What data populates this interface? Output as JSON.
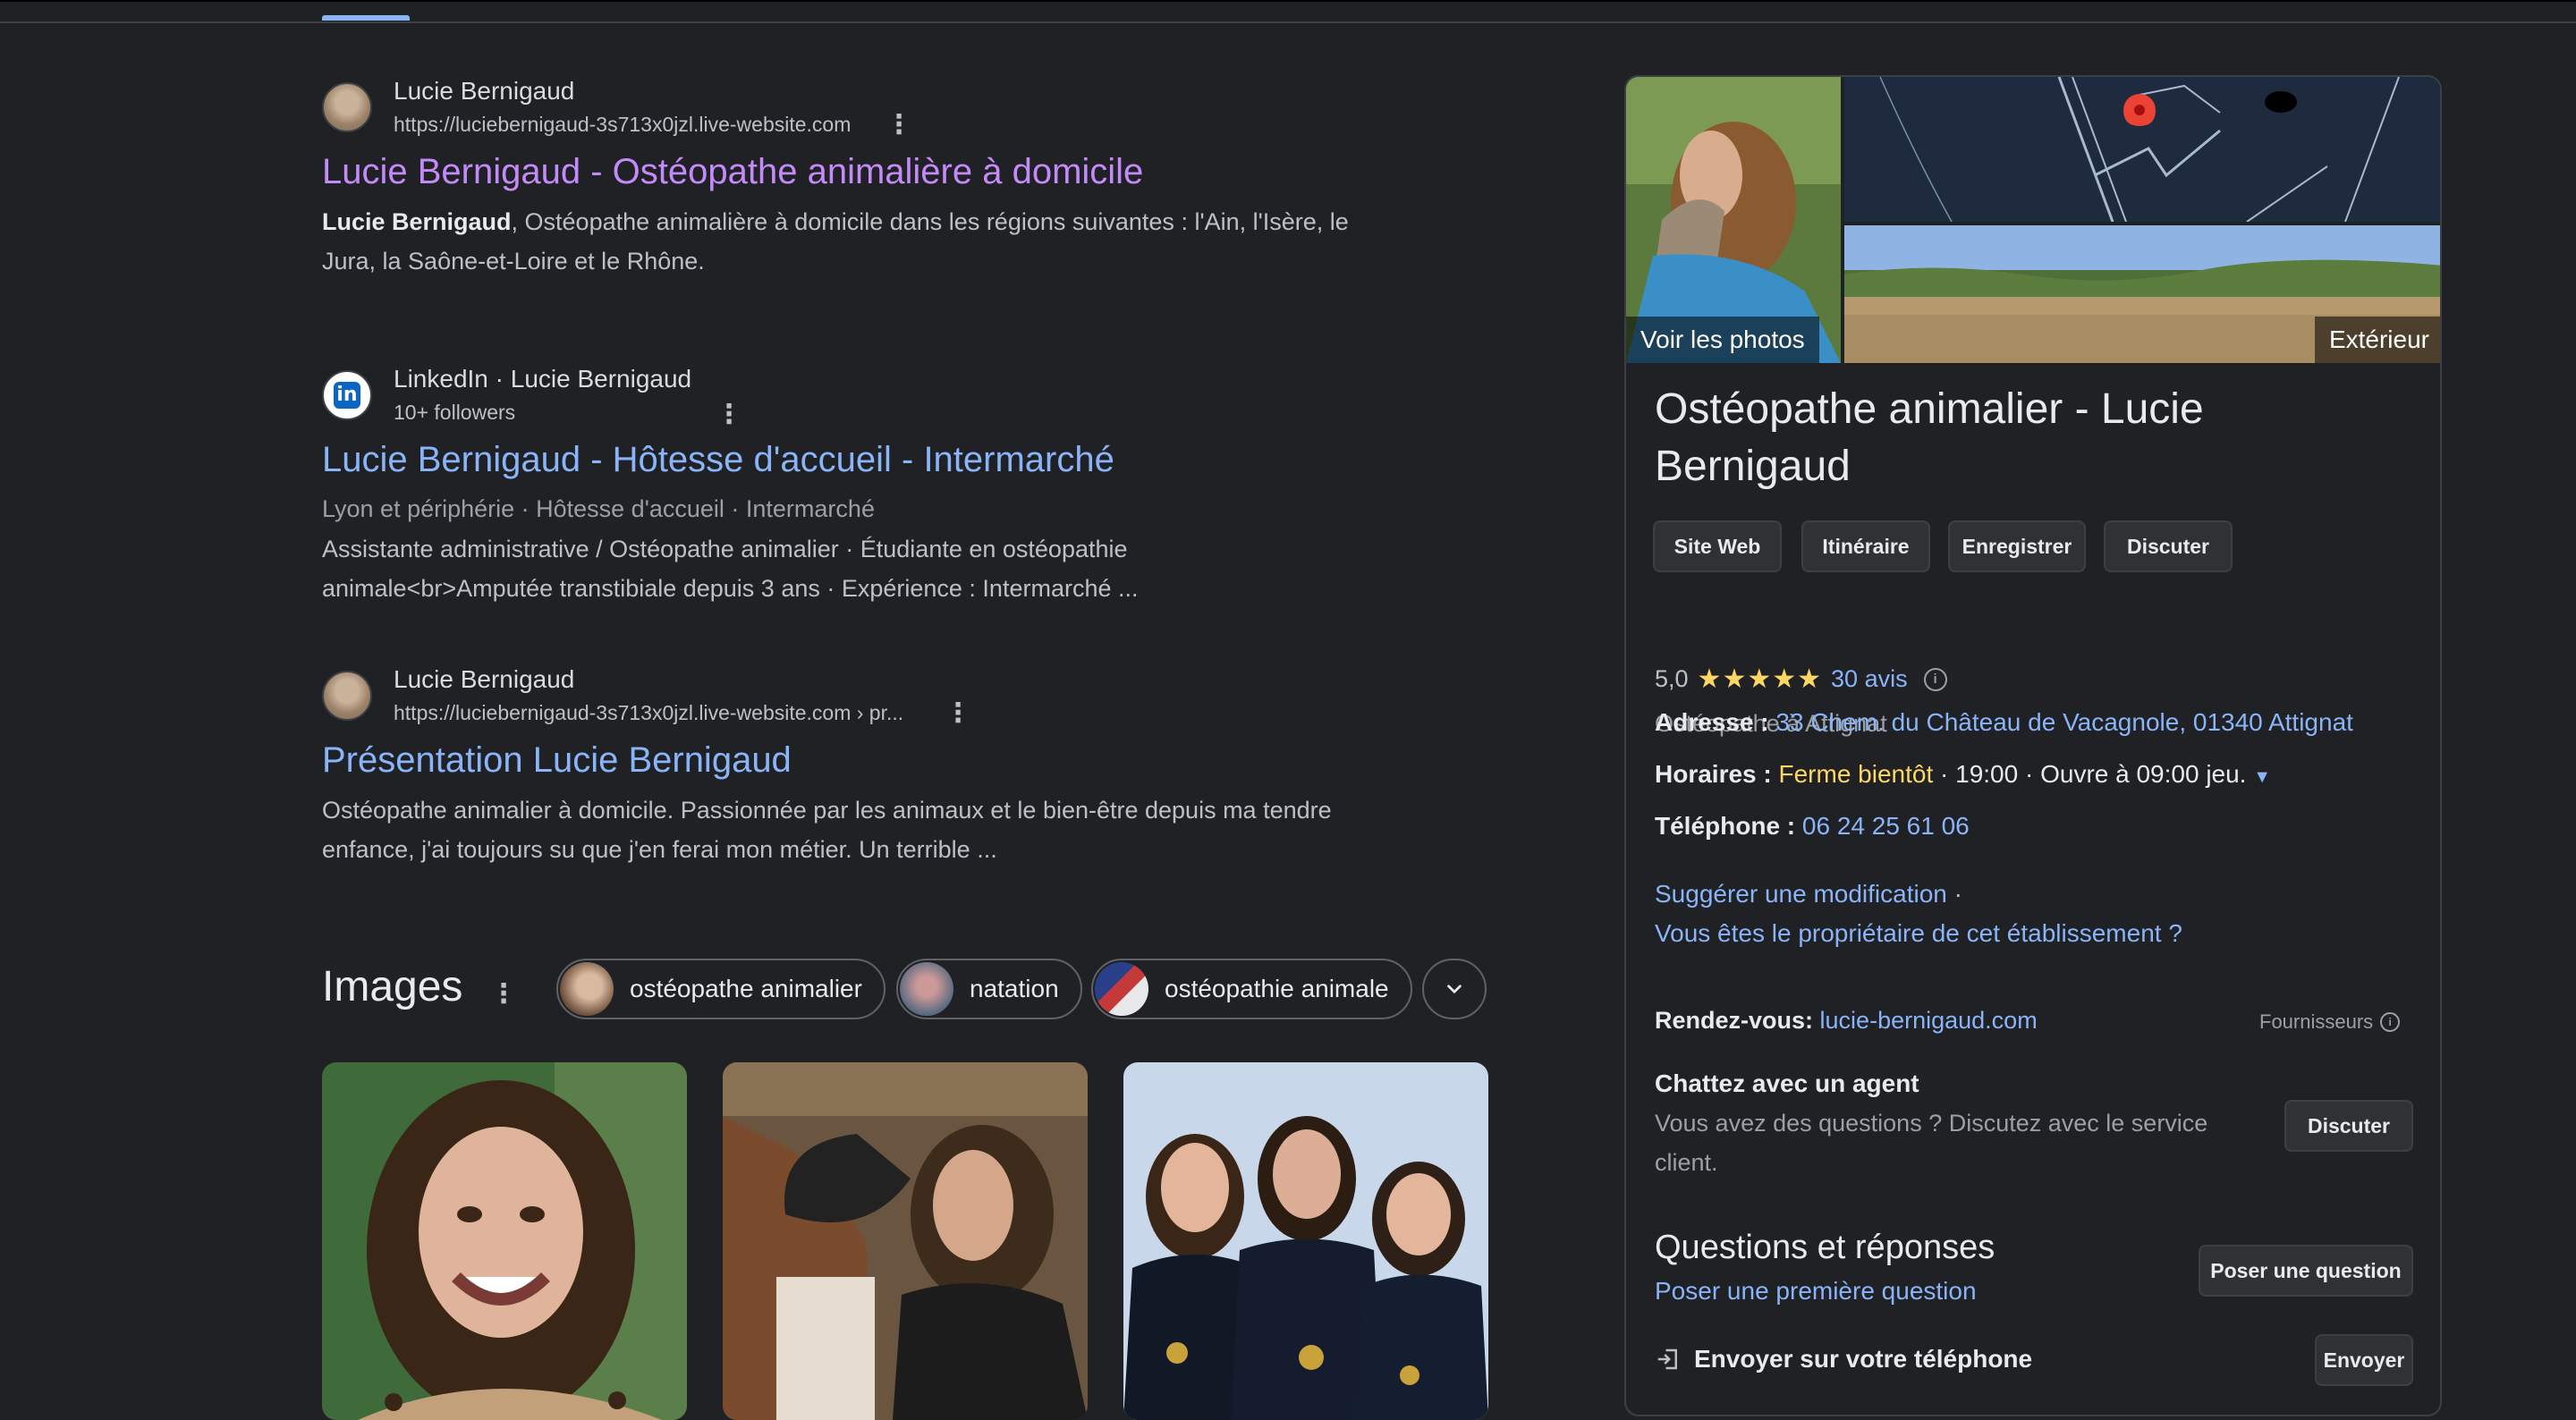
{
  "results": [
    {
      "site_name": "Lucie Bernigaud",
      "url": "https://luciebernigaud-3s713x0jzl.live-website.com",
      "title": "Lucie Bernigaud - Ostéopathe animalière à domicile",
      "snippet_bold": "Lucie Bernigaud",
      "snippet_line1": ", Ostéopathe animalière à domicile dans les régions suivantes : l'Ain, l'Isère, le",
      "snippet_line2": "Jura, la Saône-et-Loire et le Rhône."
    },
    {
      "site_name": "LinkedIn · Lucie Bernigaud",
      "url": "10+ followers",
      "title": "Lucie Bernigaud - Hôtesse d'accueil - Intermarché",
      "meta": "Lyon et périphérie · Hôtesse d'accueil · Intermarché",
      "snippet_line1": "Assistante administrative / Ostéopathe animalier · Étudiante en ostéopathie",
      "snippet_line2": "animale<br>Amputée transtibiale depuis 3 ans · Expérience : Intermarché ..."
    },
    {
      "site_name": "Lucie Bernigaud",
      "url": "https://luciebernigaud-3s713x0jzl.live-website.com › pr...",
      "title": "Présentation Lucie Bernigaud",
      "snippet_line1": "Ostéopathe animalier à domicile. Passionnée par les animaux et le bien-être depuis ma tendre",
      "snippet_line2": "enfance, j'ai toujours su que j'en ferai mon métier. Un terrible ..."
    }
  ],
  "images": {
    "title": "Images",
    "chips": [
      "ostéopathe animalier",
      "natation",
      "ostéopathie animale"
    ]
  },
  "panel": {
    "photos_label": "Voir les photos",
    "exterior_label": "Extérieur",
    "title": "Ostéopathe animalier - Lucie Bernigaud",
    "buttons": [
      "Site Web",
      "Itinéraire",
      "Enregistrer",
      "Discuter"
    ],
    "rating_value": "5,0",
    "stars": "★★★★★",
    "reviews": "30 avis",
    "category": "Ostéopathe à Attignat",
    "address_label": "Adresse :",
    "address": "33 Chem. du Château de Vacagnole, 01340 Attignat",
    "hours_label": "Horaires :",
    "hours_status": "Ferme bientôt",
    "hours_close": "· 19:00 · Ouvre à 09:00 jeu.",
    "phone_label": "Téléphone :",
    "phone": "06 24 25 61 06",
    "suggest": "Suggérer une modification",
    "suggest_sep": "·",
    "owner": "Vous êtes le propriétaire de cet établissement ?",
    "booking_label": "Rendez-vous:",
    "booking_link": "lucie-bernigaud.com",
    "providers": "Fournisseurs",
    "chat_title": "Chattez avec un agent",
    "chat_line1": "Vous avez des questions ? Discutez avec le service",
    "chat_line2": "client.",
    "chat_button": "Discuter",
    "qa_title": "Questions et réponses",
    "qa_link": "Poser une première question",
    "qa_button": "Poser une question",
    "send_label": "Envoyer sur votre téléphone",
    "send_button": "Envoyer"
  },
  "colors": {
    "background": "#202124",
    "link": "#8ab4f8",
    "visited": "#c58af9",
    "star": "#fdd663"
  }
}
